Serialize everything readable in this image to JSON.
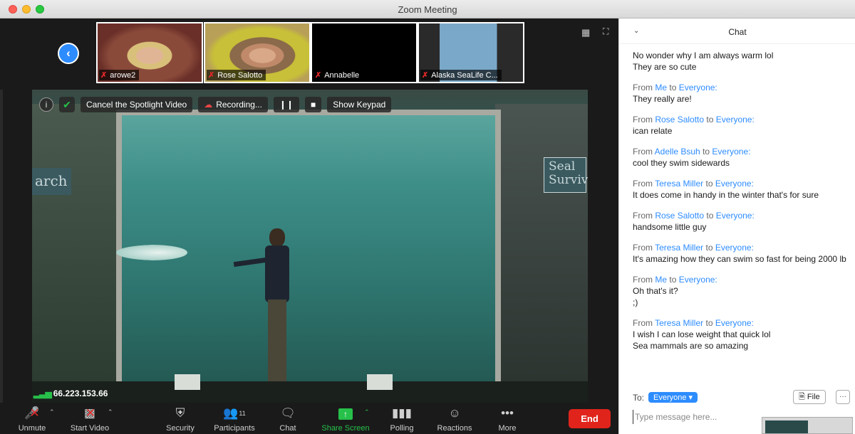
{
  "window": {
    "title": "Zoom Meeting"
  },
  "thumbnails": [
    {
      "name": "arowe2"
    },
    {
      "name": "Rose Salotto"
    },
    {
      "name": "Annabelle"
    },
    {
      "name": "Alaska SeaLife C..."
    }
  ],
  "overlay": {
    "cancel_spotlight": "Cancel the Spotlight Video",
    "recording": "Recording...",
    "show_keypad": "Show Keypad"
  },
  "video": {
    "sign_left": "arch",
    "sign_right_line1": "Seal",
    "sign_right_line2": "Surviv"
  },
  "connection": {
    "ip": "66.223.153.66"
  },
  "toolbar": {
    "unmute": "Unmute",
    "start_video": "Start Video",
    "security": "Security",
    "participants": "Participants",
    "participants_count": "11",
    "chat": "Chat",
    "share_screen": "Share Screen",
    "polling": "Polling",
    "reactions": "Reactions",
    "more": "More",
    "end": "End"
  },
  "chat": {
    "title": "Chat",
    "messages": [
      {
        "from": "",
        "to": "",
        "lines": [
          "No wonder why I am always warm lol",
          "They are so cute"
        ]
      },
      {
        "from": "Me",
        "to": "Everyone:",
        "lines": [
          "They really are!"
        ]
      },
      {
        "from": "Rose Salotto",
        "to": "Everyone:",
        "lines": [
          "ican relate"
        ]
      },
      {
        "from": "Adelle Bsuh",
        "to": "Everyone:",
        "lines": [
          "cool they swim sidewards"
        ]
      },
      {
        "from": "Teresa Miller",
        "to": "Everyone:",
        "lines": [
          "It does come in handy in the winter that's for sure"
        ]
      },
      {
        "from": "Rose Salotto",
        "to": "Everyone:",
        "lines": [
          "handsome little guy"
        ]
      },
      {
        "from": "Teresa Miller",
        "to": "Everyone:",
        "lines": [
          "It's amazing how they can swim so fast for being 2000 lb"
        ]
      },
      {
        "from": "Me",
        "to": "Everyone:",
        "lines": [
          "Oh that's it?",
          ";)"
        ]
      },
      {
        "from": "Teresa Miller",
        "to": "Everyone:",
        "lines": [
          "I wish I can lose weight that quick lol",
          "Sea mammals are so amazing"
        ]
      }
    ],
    "from_word": "From",
    "to_word": "to",
    "to_label": "To:",
    "recipient": "Everyone",
    "file_button": "File",
    "more_button": "···",
    "placeholder": "Type message here..."
  }
}
